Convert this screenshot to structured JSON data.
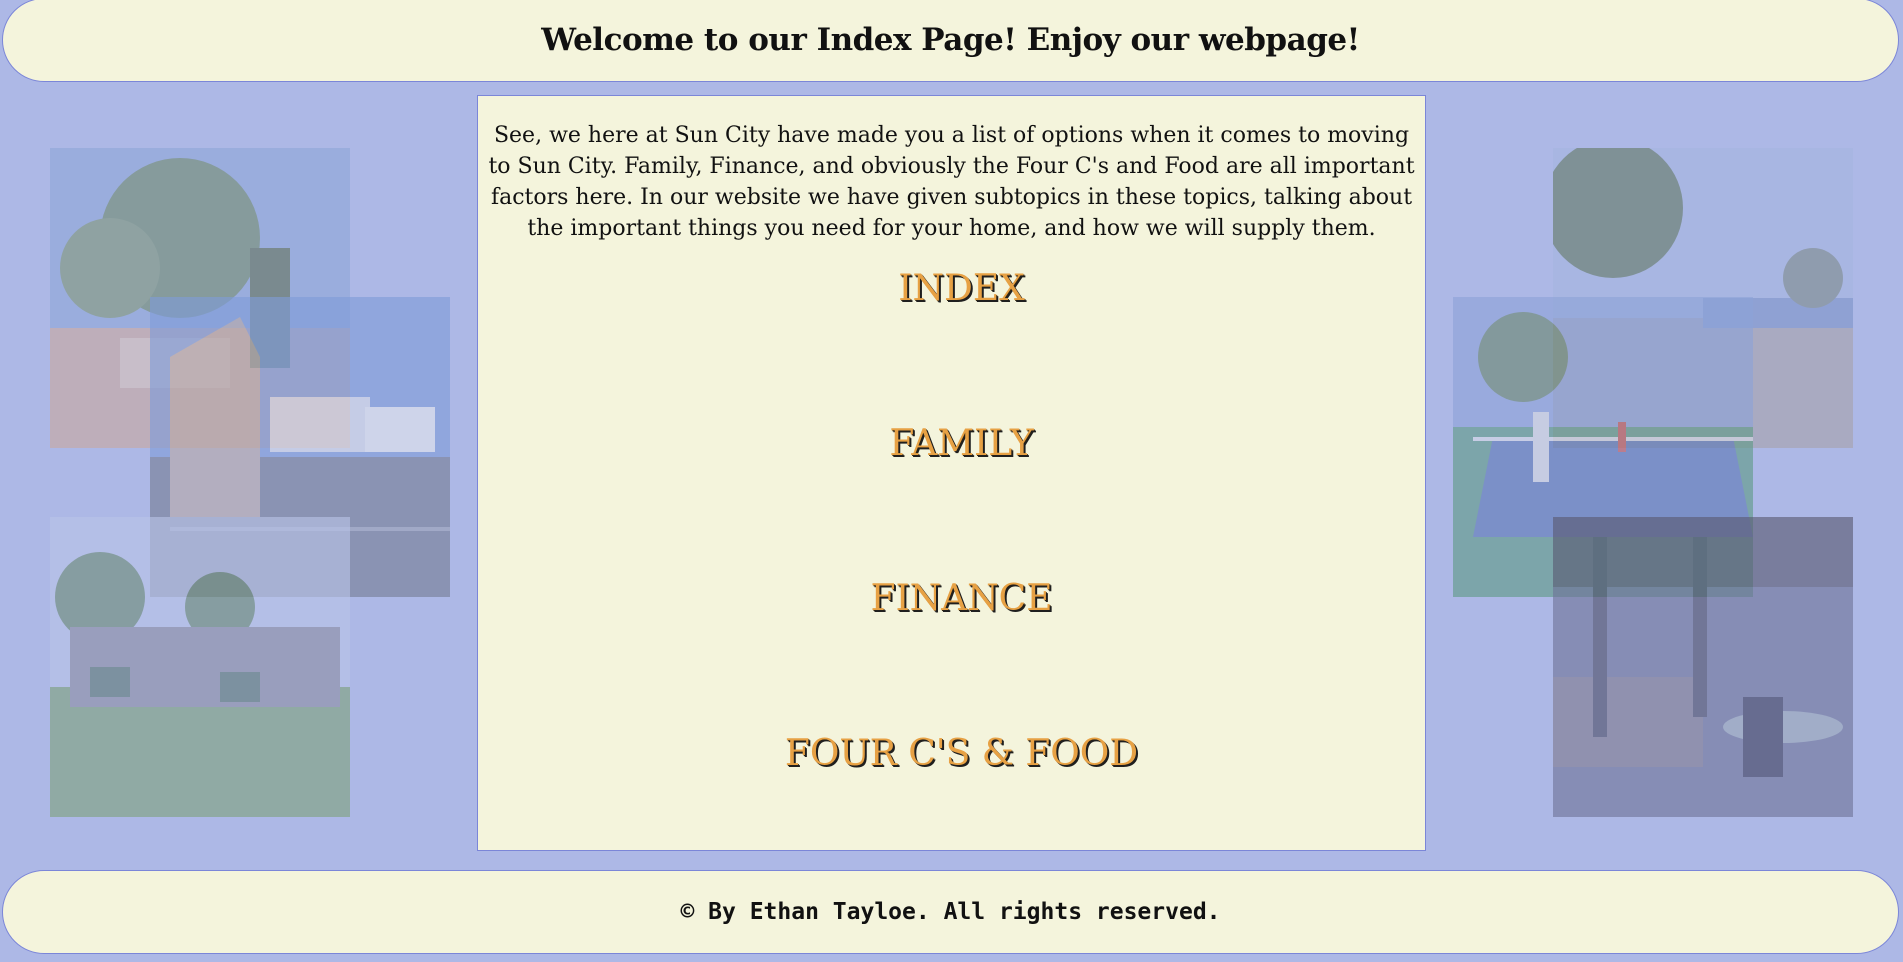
{
  "header": {
    "title": "Welcome to our Index Page! Enjoy our webpage!"
  },
  "main": {
    "intro": "See, we here at Sun City have made you a list of options when it comes to moving to Sun City. Family, Finance, and obviously the Four C's and Food are all important factors here. In our website we have given subtopics in these topics, talking about the important things you need for your home, and how we will supply them.",
    "nav": [
      {
        "label": "INDEX"
      },
      {
        "label": "FAMILY"
      },
      {
        "label": "FINANCE"
      },
      {
        "label": "FOUR C'S & FOOD"
      }
    ]
  },
  "photos": {
    "left": [
      "community-entrance-sign-photo",
      "rv-park-street-photo",
      "shuffleboard-courts-photo"
    ],
    "right": [
      "golf-course-pond-photo",
      "tennis-court-photo",
      "restaurant-patio-photo"
    ]
  },
  "footer": {
    "text": "© By Ethan Tayloe. All rights reserved."
  },
  "colors": {
    "background": "#adb8e6",
    "panel": "#f4f4dc",
    "border": "#7b86d8",
    "nav_text": "#e7a144"
  }
}
